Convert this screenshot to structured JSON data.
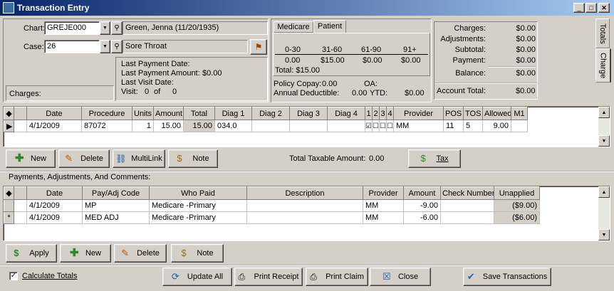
{
  "window": {
    "title": "Transaction Entry"
  },
  "header": {
    "chart_label": "Chart:",
    "chart_value": "GREJE000",
    "patient_name": "Green, Jenna  (11/20/1935)",
    "case_label": "Case:",
    "case_value": "26",
    "case_desc": "Sore Throat",
    "last_payment_date_label": "Last Payment Date:",
    "last_payment_amount_label": "Last Payment Amount:",
    "last_payment_amount": "$0.00",
    "last_visit_date_label": "Last Visit Date:",
    "visit_label": "Visit:",
    "visit_num": "0",
    "visit_of": "of",
    "visit_total": "0",
    "charges_label": "Charges:"
  },
  "aging": {
    "tabs": [
      "Medicare",
      "Patient"
    ],
    "active_tab": "Patient",
    "headers": [
      "0-30",
      "31-60",
      "61-90",
      "91+"
    ],
    "values": [
      "0.00",
      "$15.00",
      "$0.00",
      "$0.00"
    ],
    "total": "Total: $15.00",
    "policy_copay_label": "Policy Copay:",
    "policy_copay": "0.00",
    "oa_label": "OA:",
    "annual_deductible_label": "Annual Deductible:",
    "annual_deductible": "0.00",
    "ytd_label": "YTD:",
    "ytd": "$0.00"
  },
  "summary": {
    "rows": [
      {
        "label": "Charges:",
        "value": "$0.00"
      },
      {
        "label": "Adjustments:",
        "value": "$0.00"
      },
      {
        "label": "Subtotal:",
        "value": "$0.00"
      },
      {
        "label": "Payment:",
        "value": "$0.00"
      },
      {
        "label": "Balance:",
        "value": "$0.00"
      }
    ],
    "account_total_label": "Account Total:",
    "account_total": "$0.00"
  },
  "side_tabs": [
    "Totals",
    "Charge"
  ],
  "charges": {
    "columns": [
      "Date",
      "Procedure",
      "Units",
      "Amount",
      "Total",
      "Diag 1",
      "Diag 2",
      "Diag 3",
      "Diag 4",
      "1",
      "2",
      "3",
      "4",
      "Provider",
      "POS",
      "TOS",
      "Allowed",
      "M1"
    ],
    "rows": [
      {
        "date": "4/1/2009",
        "procedure": "87072",
        "units": "1",
        "amount": "15.00",
        "total": "15.00",
        "diag1": "034.0",
        "diag2": "",
        "diag3": "",
        "diag4": "",
        "c1": true,
        "c2": false,
        "c3": false,
        "c4": false,
        "provider": "MM",
        "pos": "11",
        "tos": "5",
        "allowed": "9.00",
        "m1": ""
      }
    ],
    "buttons": {
      "new": "New",
      "delete": "Delete",
      "multilink": "MultiLink",
      "note": "Note",
      "tax": "Tax"
    },
    "total_taxable_label": "Total Taxable Amount:",
    "total_taxable": "0.00"
  },
  "payments": {
    "section_label": "Payments, Adjustments, And Comments:",
    "columns": [
      "Date",
      "Pay/Adj Code",
      "Who Paid",
      "Description",
      "Provider",
      "Amount",
      "Check Number",
      "Unapplied"
    ],
    "rows": [
      {
        "date": "4/1/2009",
        "code": "MP",
        "who": "Medicare -Primary",
        "desc": "",
        "provider": "MM",
        "amount": "-9.00",
        "check": "",
        "unapplied": "($9.00)"
      },
      {
        "date": "4/1/2009",
        "code": "MED ADJ",
        "who": "Medicare -Primary",
        "desc": "",
        "provider": "MM",
        "amount": "-6.00",
        "check": "",
        "unapplied": "($6.00)"
      }
    ],
    "buttons": {
      "apply": "Apply",
      "new": "New",
      "delete": "Delete",
      "note": "Note"
    }
  },
  "footer": {
    "calculate_totals": "Calculate Totals",
    "update_all": "Update All",
    "print_receipt": "Print Receipt",
    "print_claim": "Print Claim",
    "close": "Close",
    "save": "Save Transactions"
  }
}
